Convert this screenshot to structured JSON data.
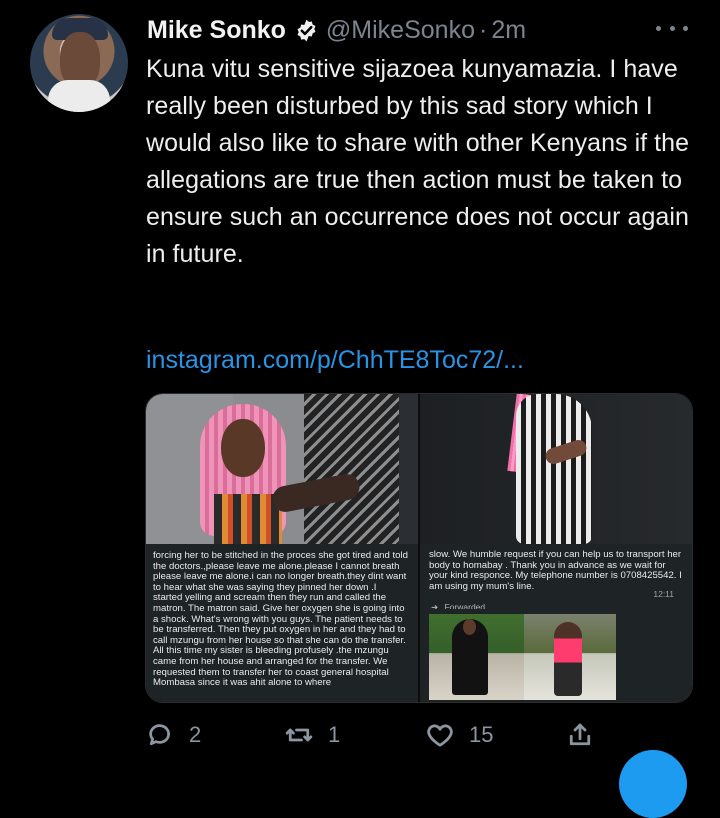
{
  "post": {
    "display_name": "Mike Sonko",
    "handle": "@MikeSonko",
    "separator": "·",
    "time_ago": "2m",
    "body": "Kuna vitu sensitive sijazoea kunyamazia. I have really been disturbed by this sad story which I would also like to share with other Kenyans if the allegations are true then action must be taken to ensure such an occurrence does not occur again in future.",
    "link_text": "instagram.com/p/ChhTE8Toc72/..."
  },
  "media_text": {
    "left_message": "forcing her to be stitched in the proces she got tired and told the doctors.,please leave me alone.please I cannot breath please leave me alone.i can no longer breath.they dint want to hear what she was saying they pinned her down .I started yelling and scream then they run and called the matron. The matron said. Give her oxygen she is going into a shock. What's wrong with you guys. The patient needs to be transferred. Then they put oxygen in her and they had to call mzungu from her house so that she can do the transfer. All this time my sister is bleeding profusely .the mzungu came from her house and arranged for the transfer. We requested them to transfer her to coast general hospital Mombasa since it was ahit alone to where",
    "right_message": "slow. We humble request if you can help us to transport her body to homabay . Thank you in advance as we wait for your kind responce. My telephone number is 0708425542. I am using my mum's line.",
    "chat_time": "12:11",
    "forwarded_label": "Forwarded"
  },
  "actions": {
    "replies": "2",
    "retweets": "1",
    "likes": "15"
  },
  "icons": {
    "verified": "verified-badge-icon",
    "more": "more-options-icon",
    "reply": "reply-icon",
    "retweet": "retweet-icon",
    "like": "heart-icon",
    "share": "share-icon",
    "compose": "compose-button"
  },
  "colors": {
    "background": "#000000",
    "primary_text": "#e7e9ea",
    "secondary_text": "#7b8590",
    "link": "#2894e6",
    "accent": "#1d9bf0"
  }
}
